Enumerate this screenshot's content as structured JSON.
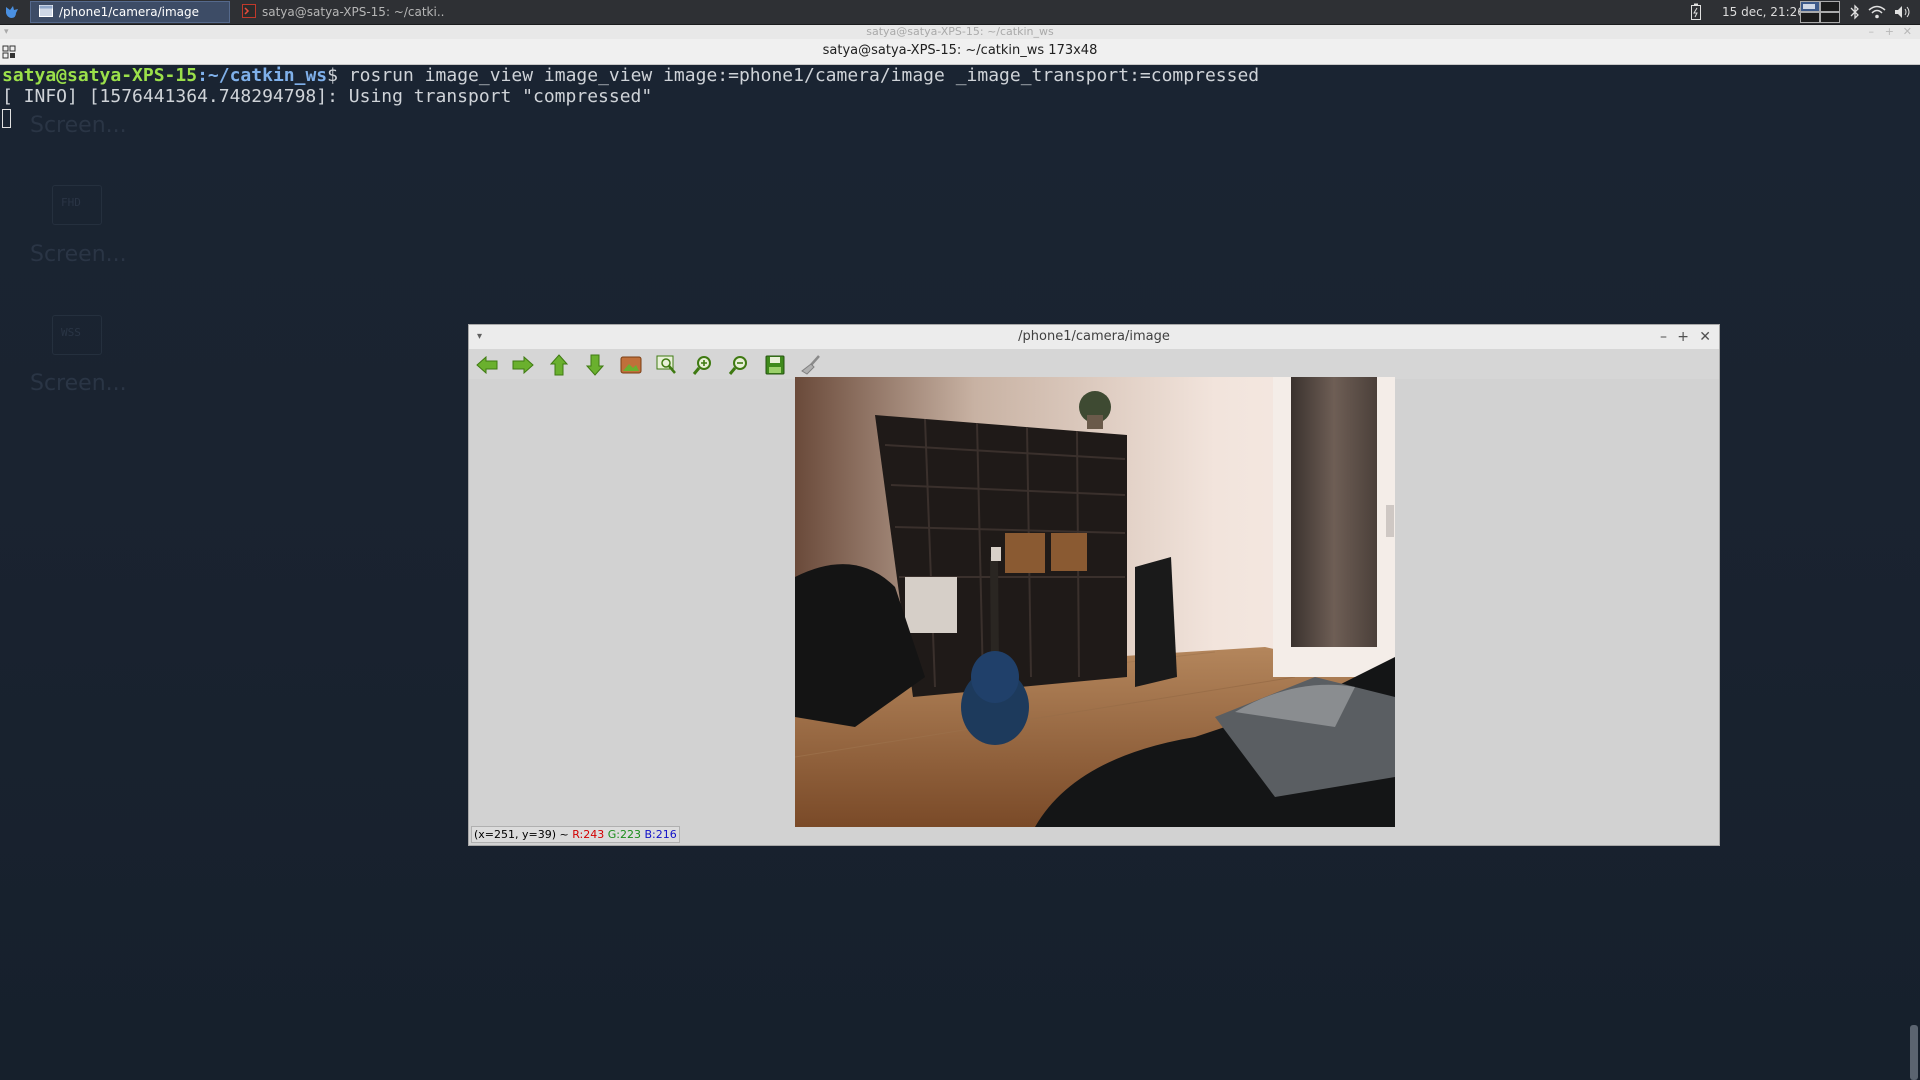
{
  "taskbar": {
    "tasks": [
      {
        "label": "/phone1/camera/image",
        "active": true
      },
      {
        "label": "satya@satya-XPS-15: ~/catki..."
      }
    ],
    "clock": "15 dec, 21:26"
  },
  "terminal": {
    "title_faded": "satya@satya-XPS-15: ~/catkin_ws",
    "header": "satya@satya-XPS-15: ~/catkin_ws 173x48",
    "prompt_user": "satya@satya-XPS-15",
    "prompt_sep": ":",
    "prompt_path": "~/catkin_ws",
    "prompt_symbol": "$ ",
    "command": "rosrun image_view image_view image:=phone1/camera/image _image_transport:=compressed",
    "output_line": "[ INFO] [1576441364.748294798]: Using transport \"compressed\"",
    "ghost_labels": [
      "Screen...",
      "Screen...",
      "Screen..."
    ],
    "ghost_box_labels": [
      "FHD",
      "WSS"
    ]
  },
  "image_view": {
    "title": "/phone1/camera/image",
    "toolbar_icons": [
      "arrow-left-icon",
      "arrow-right-icon",
      "arrow-up-icon",
      "arrow-down-icon",
      "image-icon",
      "zoom-fit-icon",
      "zoom-in-icon",
      "zoom-out-icon",
      "save-icon",
      "clear-icon"
    ],
    "status": {
      "coords": "(x=251, y=39) ~",
      "r": "R:243",
      "g": "G:223",
      "b": "B:216"
    }
  },
  "colors": {
    "accent_green": "#66a82a",
    "terminal_bg": "#1a2432",
    "prompt_green": "#9be04a",
    "prompt_blue": "#7fb0ea"
  }
}
